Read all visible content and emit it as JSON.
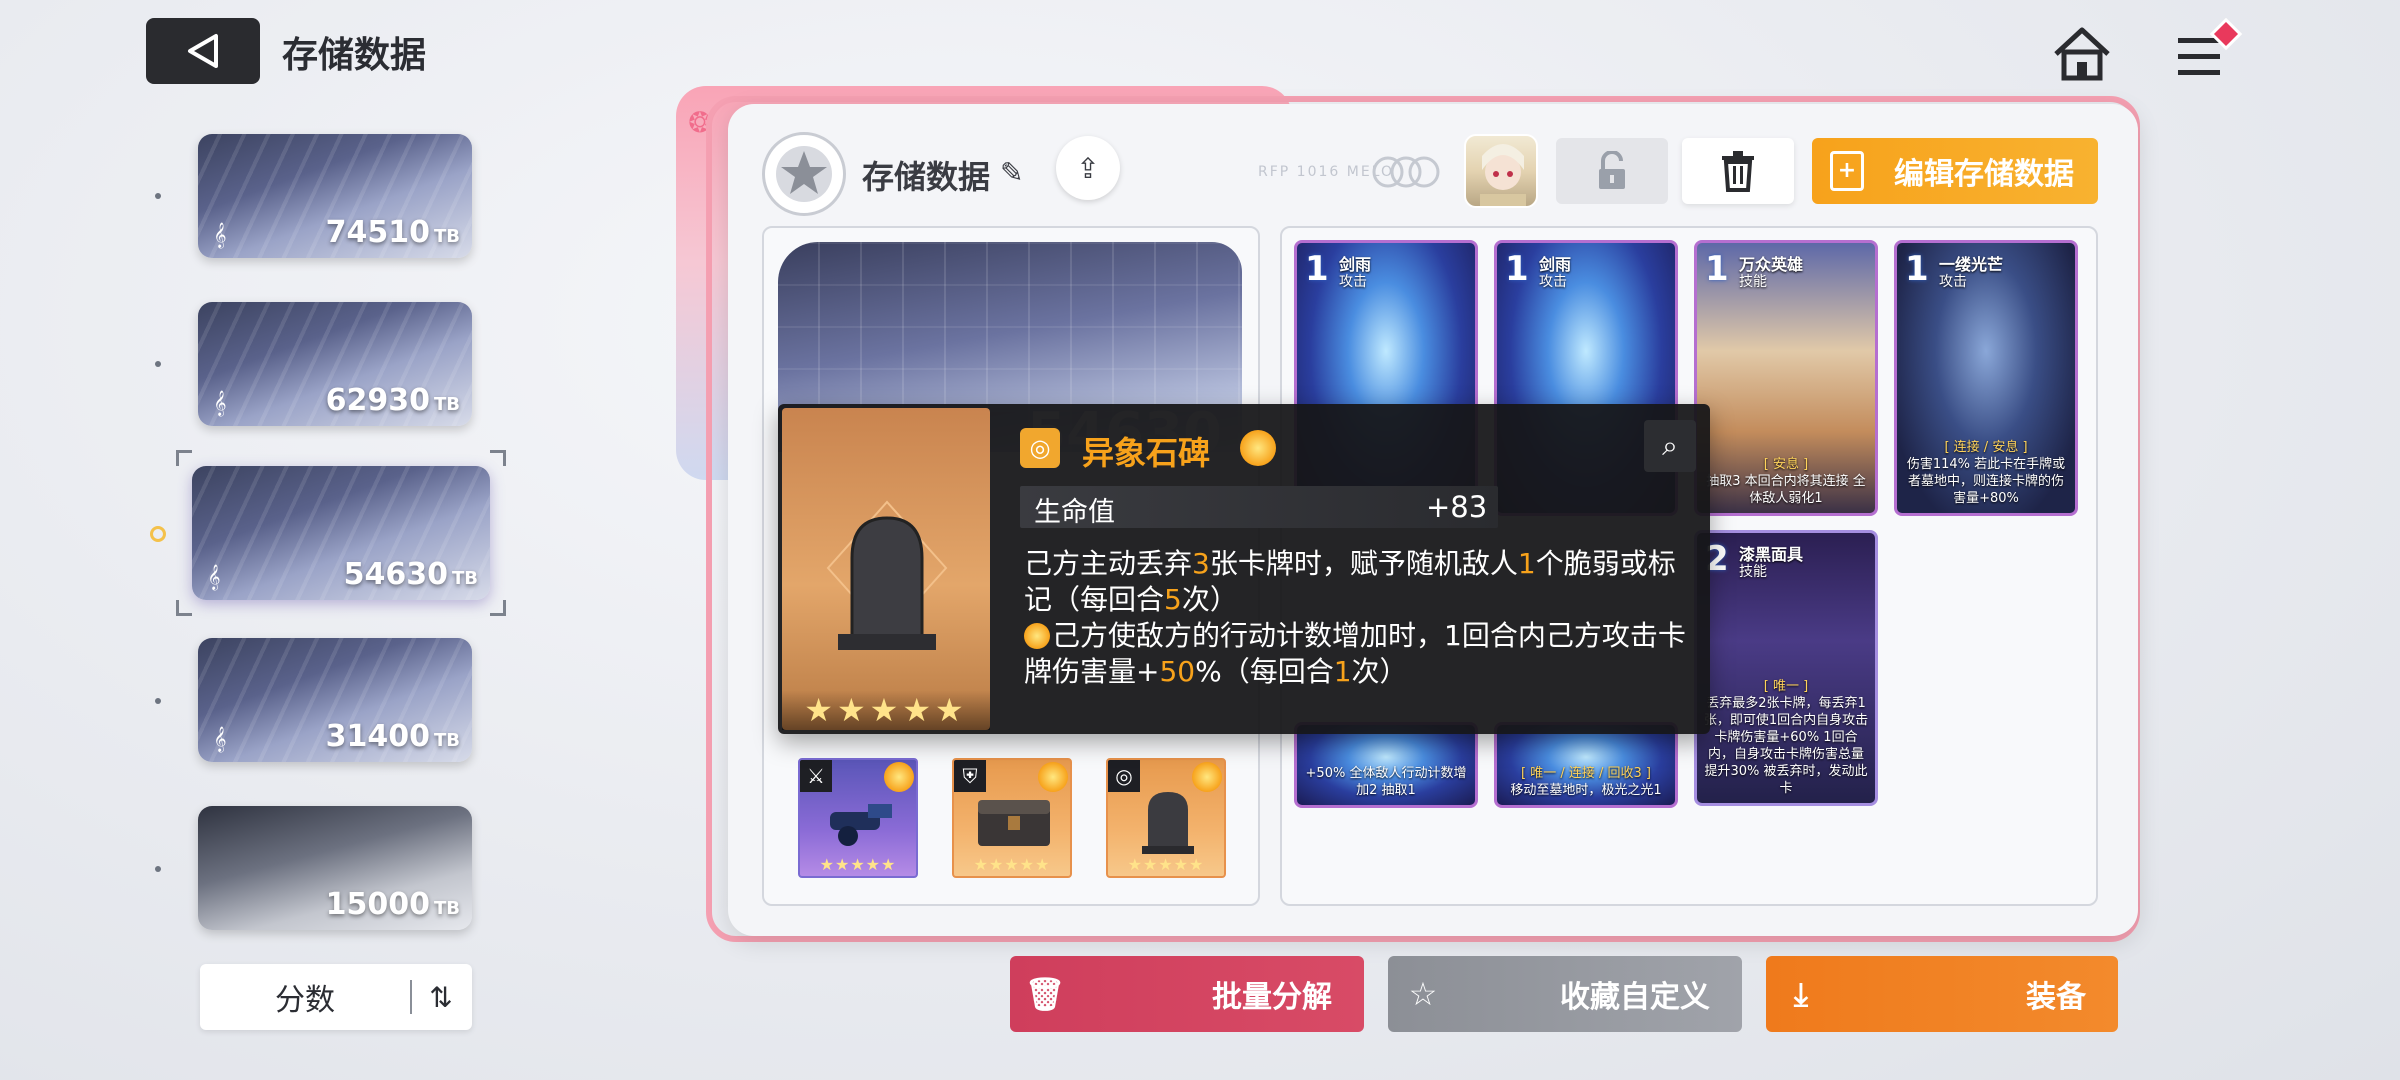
{
  "header": {
    "title": "存储数据"
  },
  "slots": [
    {
      "value": "74510",
      "unit": "TB"
    },
    {
      "value": "62930",
      "unit": "TB"
    },
    {
      "value": "54630",
      "unit": "TB"
    },
    {
      "value": "31400",
      "unit": "TB"
    },
    {
      "value": "15000",
      "unit": "TB"
    }
  ],
  "sort": {
    "label": "分数"
  },
  "panel": {
    "save_name": "存储数据",
    "faint_text": "RFP 1016 MELO",
    "edit_button": "编辑存储数据"
  },
  "preview": {
    "value": "54630"
  },
  "cards": [
    {
      "cost": "1",
      "name": "剑雨",
      "type": "攻击",
      "desc": ""
    },
    {
      "cost": "1",
      "name": "剑雨",
      "type": "攻击",
      "desc": ""
    },
    {
      "cost": "1",
      "name": "万众英雄",
      "type": "技能",
      "tag": "[ 安息 ]",
      "desc": "抽取3 本回合内将其连接 全体敌人弱化1"
    },
    {
      "cost": "1",
      "name": "一缕光芒",
      "type": "攻击",
      "tag": "[ 连接 / 安息 ]",
      "desc": "伤害114% 若此卡在手牌或者墓地中，则连接卡牌的伤害量+80%"
    },
    {
      "cost": "",
      "name": "",
      "type": "",
      "desc": "+50% 全体敌人行动计数增加2 抽取1"
    },
    {
      "cost": "",
      "name": "",
      "type": "",
      "tag": "[ 唯一 / 连接 / 回收3 ]",
      "desc": "移动至墓地时，极光之光1"
    },
    {
      "cost": "2",
      "name": "漆黑面具",
      "type": "技能",
      "tag": "[ 唯一 ]",
      "desc": "丢弃最多2张卡牌，每丢弃1张，即可使1回合内自身攻击卡牌伤害量+60% 1回合内，自身攻击卡牌伤害总量提升30% 被丢弃时，发动此卡"
    }
  ],
  "tooltip": {
    "title": "异象石碑",
    "stat_label": "生命值",
    "stat_value": "+83",
    "desc_line1_a": "己方主动丢弃",
    "desc_line1_n1": "3",
    "desc_line1_b": "张卡牌时，赋予随机敌人",
    "desc_line1_n2": "1",
    "desc_line1_c": "个脆弱或标记（每回合",
    "desc_line1_n3": "5",
    "desc_line1_d": "次）",
    "desc_line2_a": "己方使敌方的行动计数增加时，1回合内己方攻击卡牌伤害量+",
    "desc_line2_n1": "50",
    "desc_line2_b": "%（每回合",
    "desc_line2_n2": "1",
    "desc_line2_c": "次）",
    "stars": "★★★★★"
  },
  "equipment": [
    {
      "stars": "★★★★★"
    },
    {
      "stars": "★★★★★"
    },
    {
      "stars": "★★★★★"
    }
  ],
  "actions": {
    "salvage": "批量分解",
    "collect": "收藏自定义",
    "equip": "装备"
  },
  "colors": {
    "accent_orange": "#f7a21b",
    "accent_pink": "#f5a0b2",
    "salvage_red": "#cf3e5c",
    "equip_orange": "#ef7a1c"
  }
}
